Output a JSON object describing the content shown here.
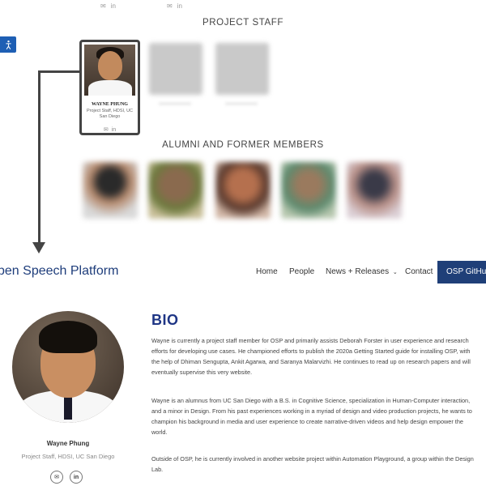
{
  "top": {
    "project_staff_title": "PROJECT STAFF",
    "alumni_title": "ALUMNI AND FORMER MEMBERS"
  },
  "staff_card": {
    "name": "WAYNE PHUNG",
    "role": "Project Staff, HDSI, UC San Diego"
  },
  "nav": {
    "brand": "pen Speech Platform",
    "items": [
      "Home",
      "People",
      "News + Releases",
      "Contact"
    ],
    "github_button": "OSP GitHub"
  },
  "profile": {
    "name": "Wayne Phung",
    "role": "Project Staff, HDSI, UC San Diego"
  },
  "bio": {
    "title": "BIO",
    "paragraphs": [
      "Wayne is currently a project staff member for OSP and primarily assists Deborah Forster in user experience and research efforts for developing use cases. He championed efforts to publish the 2020a Getting Started guide for installing OSP, with the help of Dhiman Sengupta, Ankit Agarwa, and Saranya Malarvizhi. He continues to read up on research papers and will eventually supervise this very website.",
      "Wayne is an alumnus from UC San Diego with a B.S. in Cognitive Science, specialization in Human-Computer interaction, and a minor in Design. From his past experiences working in a myriad of design and video production projects, he wants to champion his background in media and user experience to create narrative-driven videos and help design empower the world.",
      "Outside of OSP, he is currently involved in another website project within Automation Playground, a group within the Design Lab."
    ]
  },
  "icons": {
    "email": "email-icon",
    "linkedin": "linkedin-icon",
    "accessibility": "accessibility-icon"
  },
  "colors": {
    "brand": "#1e3d7b",
    "bio_title": "#1e3585",
    "nav_button": "#1f3f78",
    "arrow": "#444444"
  }
}
